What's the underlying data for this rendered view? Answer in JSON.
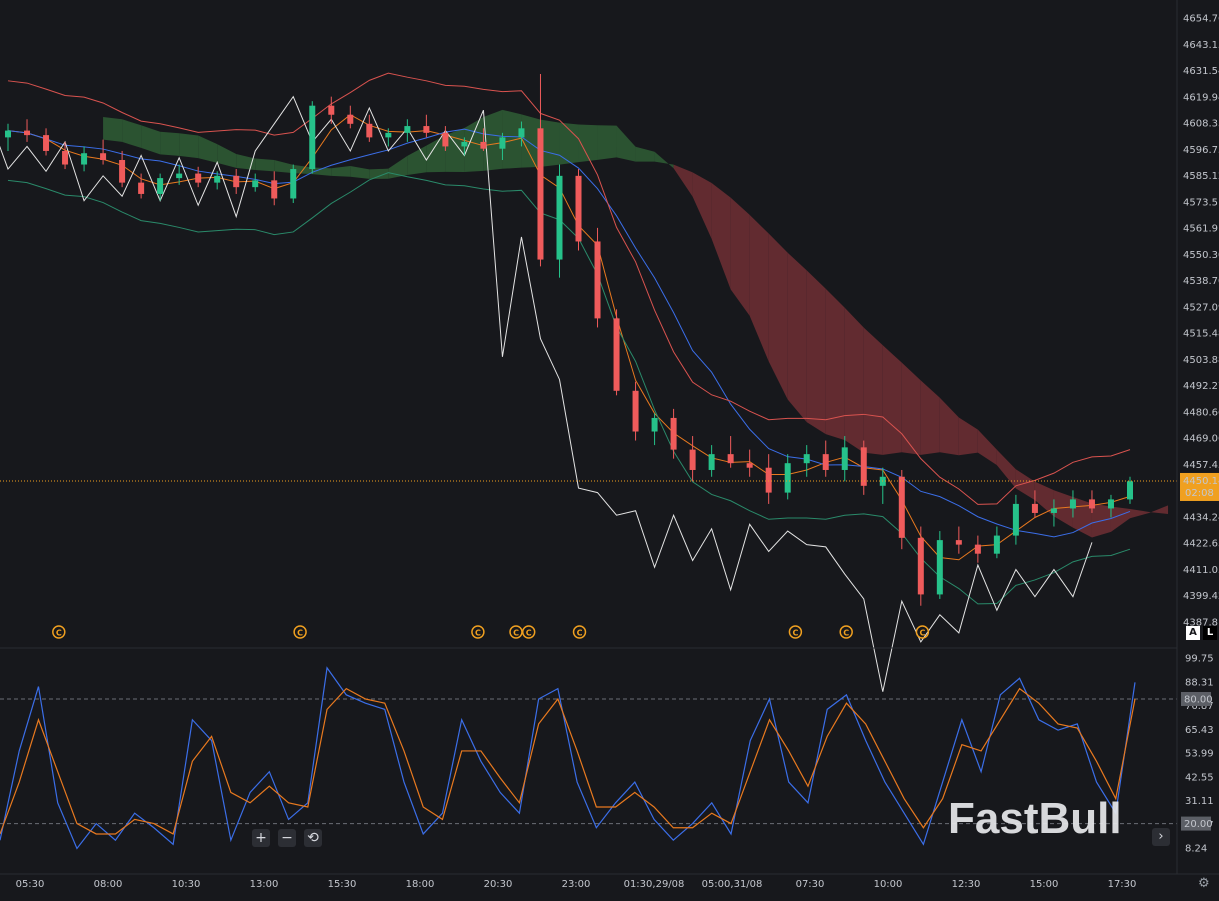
{
  "brand": {
    "logo_text": "FastBull",
    "logo_color": "#e8e9ec"
  },
  "price_axis": {
    "labels": [
      "4654.76",
      "4643.15",
      "4631.54",
      "4619.94",
      "4608.33",
      "4596.73",
      "4585.12",
      "4573.51",
      "4561.91",
      "4550.30",
      "4538.70",
      "4527.09",
      "4515.48",
      "4503.88",
      "4492.27",
      "4480.66",
      "4469.06",
      "4457.45",
      "4445.84",
      "4434.24",
      "4422.63",
      "4411.03",
      "4399.42",
      "4387.81"
    ]
  },
  "current_price": {
    "value": "4450.14",
    "countdown": "02:08",
    "color": "#f0a020"
  },
  "osc_axis": {
    "labels": [
      "99.75",
      "88.31",
      "76.87",
      "65.43",
      "53.99",
      "42.55",
      "31.11",
      "19.67",
      "8.24"
    ]
  },
  "osc_levels": {
    "upper": "80.00",
    "lower": "20.00"
  },
  "time_axis": {
    "labels": [
      "05:30",
      "08:00",
      "10:30",
      "13:00",
      "15:30",
      "18:00",
      "20:30",
      "23:00",
      "01:30,29/08",
      "05:00,31/08",
      "07:30",
      "10:00",
      "12:30",
      "15:00",
      "17:30"
    ]
  },
  "mode_buttons": {
    "auto": "A",
    "log": "L"
  },
  "controls": {
    "zoom_in": "+",
    "zoom_out": "−",
    "reset": "⟲",
    "next": "›",
    "settings": "⚙"
  },
  "event_markers": {
    "glyph": "C",
    "color": "#f0a020"
  },
  "colors": {
    "up": "#26c28a",
    "down": "#ef5b5b",
    "cloud_bull": "#2d5a34",
    "cloud_bear": "#6a2d33",
    "white_line": "#e4e4e4",
    "k_line": "#3b6ee8",
    "d_line": "#e8791f"
  },
  "chart_data": {
    "type": "candlestick",
    "time_labels": [
      "05:30",
      "08:00",
      "10:30",
      "13:00",
      "15:30",
      "18:00",
      "20:30",
      "23:00",
      "01:30,29/08",
      "05:00,31/08",
      "07:30",
      "10:00",
      "12:30",
      "15:00",
      "17:30"
    ],
    "y_range": [
      4387.81,
      4654.76
    ],
    "ohlc": [
      [
        4602,
        4608,
        4596,
        4605
      ],
      [
        4605,
        4610,
        4600,
        4603
      ],
      [
        4603,
        4606,
        4594,
        4596
      ],
      [
        4596,
        4600,
        4588,
        4590
      ],
      [
        4590,
        4598,
        4587,
        4595
      ],
      [
        4595,
        4601,
        4590,
        4592
      ],
      [
        4592,
        4596,
        4580,
        4582
      ],
      [
        4582,
        4586,
        4575,
        4577
      ],
      [
        4577,
        4586,
        4574,
        4584
      ],
      [
        4584,
        4590,
        4581,
        4586
      ],
      [
        4586,
        4589,
        4580,
        4582
      ],
      [
        4582,
        4587,
        4579,
        4585
      ],
      [
        4585,
        4588,
        4577,
        4580
      ],
      [
        4580,
        4586,
        4578,
        4583
      ],
      [
        4583,
        4587,
        4572,
        4575
      ],
      [
        4575,
        4590,
        4573,
        4588
      ],
      [
        4588,
        4618,
        4586,
        4616
      ],
      [
        4616,
        4620,
        4608,
        4612
      ],
      [
        4612,
        4616,
        4606,
        4608
      ],
      [
        4608,
        4612,
        4600,
        4602
      ],
      [
        4602,
        4606,
        4598,
        4604
      ],
      [
        4604,
        4610,
        4600,
        4607
      ],
      [
        4607,
        4612,
        4602,
        4604
      ],
      [
        4604,
        4607,
        4596,
        4598
      ],
      [
        4598,
        4602,
        4594,
        4600
      ],
      [
        4600,
        4606,
        4596,
        4597
      ],
      [
        4597,
        4604,
        4592,
        4602
      ],
      [
        4602,
        4609,
        4598,
        4606
      ],
      [
        4606,
        4630,
        4545,
        4548
      ],
      [
        4548,
        4590,
        4540,
        4585
      ],
      [
        4585,
        4588,
        4552,
        4556
      ],
      [
        4556,
        4562,
        4518,
        4522
      ],
      [
        4522,
        4526,
        4488,
        4490
      ],
      [
        4490,
        4494,
        4468,
        4472
      ],
      [
        4472,
        4480,
        4466,
        4478
      ],
      [
        4478,
        4482,
        4460,
        4464
      ],
      [
        4464,
        4470,
        4450,
        4455
      ],
      [
        4455,
        4466,
        4452,
        4462
      ],
      [
        4462,
        4470,
        4456,
        4458
      ],
      [
        4458,
        4464,
        4452,
        4456
      ],
      [
        4456,
        4462,
        4440,
        4445
      ],
      [
        4445,
        4462,
        4442,
        4458
      ],
      [
        4458,
        4466,
        4452,
        4462
      ],
      [
        4462,
        4468,
        4452,
        4455
      ],
      [
        4455,
        4470,
        4450,
        4465
      ],
      [
        4465,
        4468,
        4444,
        4448
      ],
      [
        4448,
        4456,
        4440,
        4452
      ],
      [
        4452,
        4455,
        4420,
        4425
      ],
      [
        4425,
        4430,
        4395,
        4400
      ],
      [
        4400,
        4428,
        4398,
        4424
      ],
      [
        4424,
        4430,
        4418,
        4422
      ],
      [
        4422,
        4426,
        4414,
        4418
      ],
      [
        4418,
        4430,
        4416,
        4426
      ],
      [
        4426,
        4444,
        4422,
        4440
      ],
      [
        4440,
        4446,
        4434,
        4436
      ],
      [
        4436,
        4442,
        4430,
        4438
      ],
      [
        4438,
        4446,
        4434,
        4442
      ],
      [
        4442,
        4446,
        4436,
        4438
      ],
      [
        4438,
        4444,
        4434,
        4442
      ],
      [
        4442,
        4452,
        4440,
        4450
      ]
    ],
    "stochastic": {
      "k": [
        12,
        55,
        86,
        30,
        8,
        20,
        12,
        25,
        18,
        10,
        70,
        60,
        12,
        35,
        45,
        22,
        30,
        95,
        82,
        78,
        75,
        40,
        15,
        25,
        70,
        50,
        35,
        25,
        80,
        85,
        40,
        18,
        30,
        40,
        22,
        12,
        20,
        30,
        15,
        60,
        80,
        40,
        30,
        75,
        82,
        60,
        40,
        25,
        10,
        40,
        70,
        45,
        82,
        90,
        70,
        65,
        68,
        40,
        25,
        88
      ],
      "d": [
        15,
        40,
        70,
        45,
        20,
        15,
        15,
        22,
        20,
        15,
        50,
        62,
        35,
        30,
        38,
        30,
        28,
        75,
        85,
        80,
        78,
        55,
        28,
        22,
        55,
        55,
        42,
        30,
        68,
        80,
        55,
        28,
        28,
        35,
        28,
        18,
        18,
        25,
        20,
        45,
        70,
        55,
        38,
        62,
        78,
        68,
        50,
        32,
        18,
        32,
        58,
        55,
        70,
        85,
        78,
        68,
        66,
        50,
        32,
        80
      ]
    }
  }
}
